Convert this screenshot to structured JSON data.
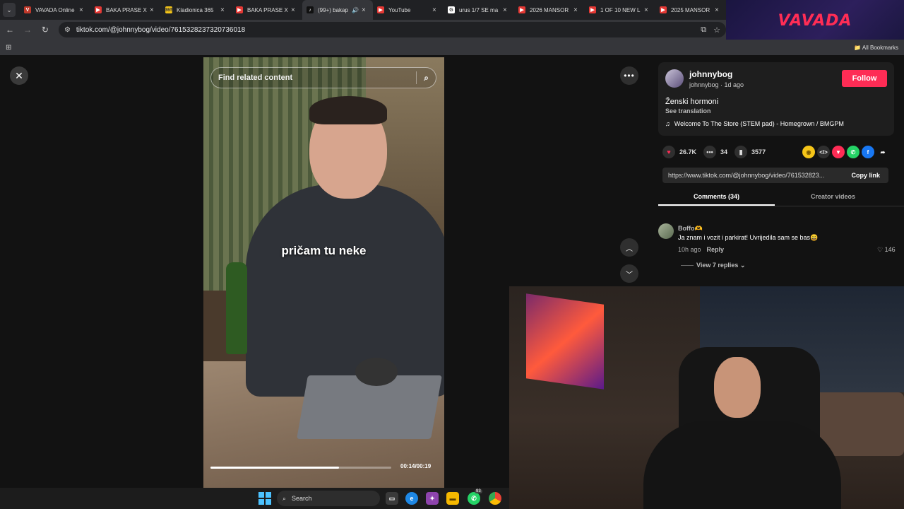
{
  "browser": {
    "tabs": [
      {
        "title": "VAVADA Online",
        "favicon": "V",
        "color": "#c0392b"
      },
      {
        "title": "BAKA PRASE X",
        "favicon": "▶",
        "color": "#e53935"
      },
      {
        "title": "Kladionica 365",
        "favicon": "365",
        "color": "#f5c518"
      },
      {
        "title": "BAKA PRASE X",
        "favicon": "▶",
        "color": "#e53935"
      },
      {
        "title": "(99+) bakap",
        "favicon": "♪",
        "color": "#111111"
      },
      {
        "title": "YouTube",
        "favicon": "▶",
        "color": "#e53935"
      },
      {
        "title": "urus 1/7 SE ma",
        "favicon": "G",
        "color": "#ffffff"
      },
      {
        "title": "2026 MANSOR",
        "favicon": "▶",
        "color": "#e53935"
      },
      {
        "title": "1 OF 10 NEW L",
        "favicon": "▶",
        "color": "#e53935"
      },
      {
        "title": "2025 MANSOR",
        "favicon": "▶",
        "color": "#e53935"
      }
    ],
    "url": "tiktok.com/@johnnybog/video/7615328237320736018",
    "bookmarks_label": "All Bookmarks"
  },
  "banner": {
    "text": "VAVADA"
  },
  "video": {
    "search_placeholder": "Find related content",
    "caption": "pričam tu neke",
    "timecode": "00:14/00:19",
    "progress_fraction": 0.71
  },
  "post": {
    "username": "johnnybog",
    "meta": "johnnybog · 1d ago",
    "follow_label": "Follow",
    "description": "Ženski hormoni",
    "see_translation": "See translation",
    "music": "Welcome To The Store (STEM pad) - Homegrown / BMGPM",
    "likes": "26.7K",
    "comments": "34",
    "saves": "3577",
    "link": "https://www.tiktok.com/@johnnybog/video/761532823...",
    "copy_link": "Copy link",
    "tab_comments": "Comments (34)",
    "tab_creator": "Creator videos"
  },
  "comment": {
    "author": "Boffo🫶",
    "text": "Ja znam i vozit i parkirat! Uvrijedila sam se bas😄",
    "time": "10h ago",
    "reply": "Reply",
    "likes": "146",
    "view_replies": "View 7 replies"
  },
  "taskbar": {
    "search": "Search",
    "whatsapp_badge": "93"
  }
}
